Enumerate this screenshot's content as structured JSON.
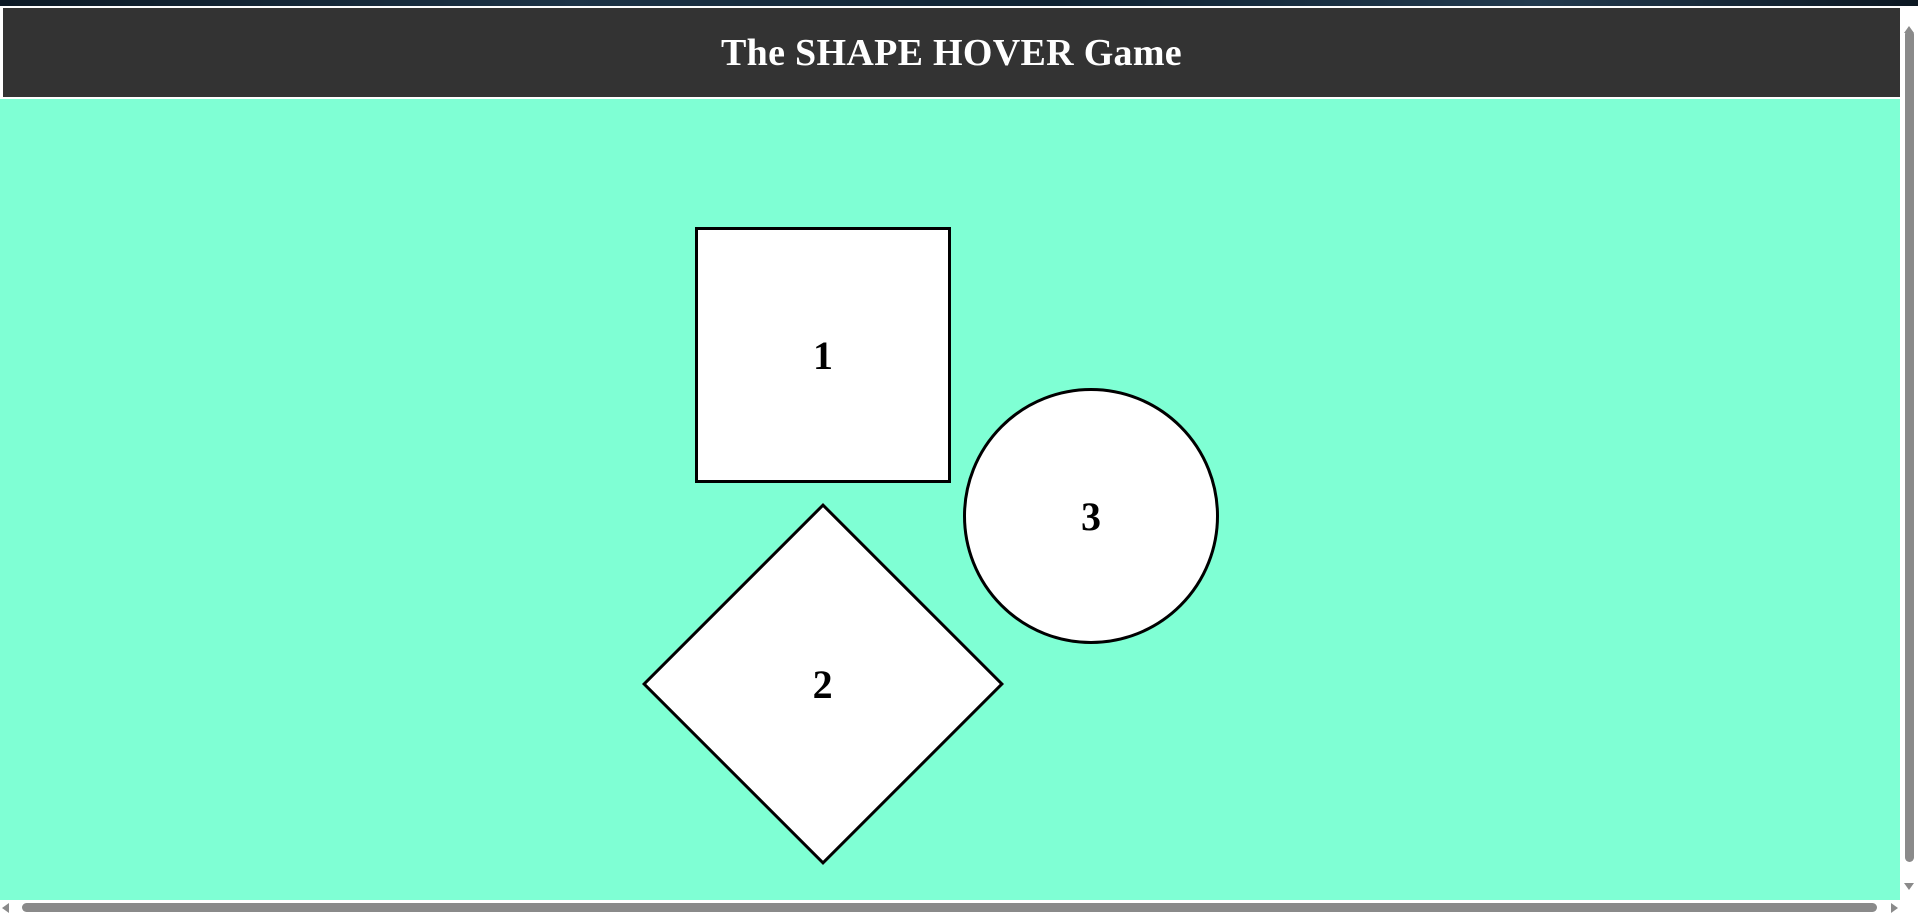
{
  "header": {
    "title": "The SHAPE HOVER Game"
  },
  "colors": {
    "header_bg": "#333333",
    "game_bg": "#7fffd4",
    "shape_fill": "#ffffff",
    "shape_border": "#000000"
  },
  "shapes": [
    {
      "kind": "square",
      "label": "1"
    },
    {
      "kind": "diamond",
      "label": "2"
    },
    {
      "kind": "circle",
      "label": "3"
    }
  ]
}
